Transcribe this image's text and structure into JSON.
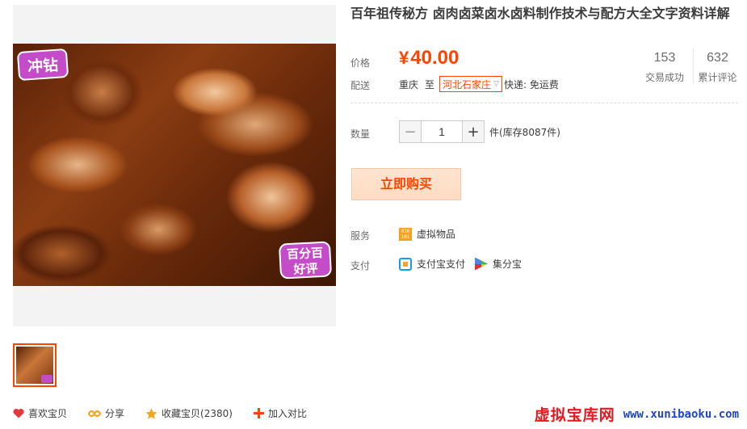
{
  "product": {
    "title": "百年祖传秘方 卤肉卤菜卤水卤料制作技术与配方大全文字资料详解",
    "image_badges": {
      "top": "冲钻",
      "bottom_line1": "百分百",
      "bottom_line2": "好评"
    }
  },
  "price": {
    "label": "价格",
    "currency": "¥",
    "amount": "40.00",
    "color": "#ff4400"
  },
  "stats": [
    {
      "value": "153",
      "label": "交易成功"
    },
    {
      "value": "632",
      "label": "累计评论"
    }
  ],
  "delivery": {
    "label": "配送",
    "from": "重庆",
    "to_prefix": "至",
    "to_city": "河北石家庄",
    "express": "快递: 免运费"
  },
  "quantity": {
    "label": "数量",
    "minus": "−",
    "value": "1",
    "plus": "+",
    "stock": "件(库存8087件)"
  },
  "buy_button": "立即购买",
  "service": {
    "label": "服务",
    "icon_text": "010 101",
    "item": "虚拟物品"
  },
  "payment": {
    "label": "支付",
    "items": [
      "支付宝支付",
      "集分宝"
    ]
  },
  "actions": [
    {
      "label": "喜欢宝贝",
      "icon": "heart-icon"
    },
    {
      "label": "分享",
      "icon": "share-icon"
    },
    {
      "label": "收藏宝贝(2380)",
      "icon": "star-icon"
    },
    {
      "label": "加入对比",
      "icon": "plus-icon"
    }
  ],
  "watermark": {
    "cn": "虚拟宝库网",
    "url": "www.xunibaoku.com"
  }
}
